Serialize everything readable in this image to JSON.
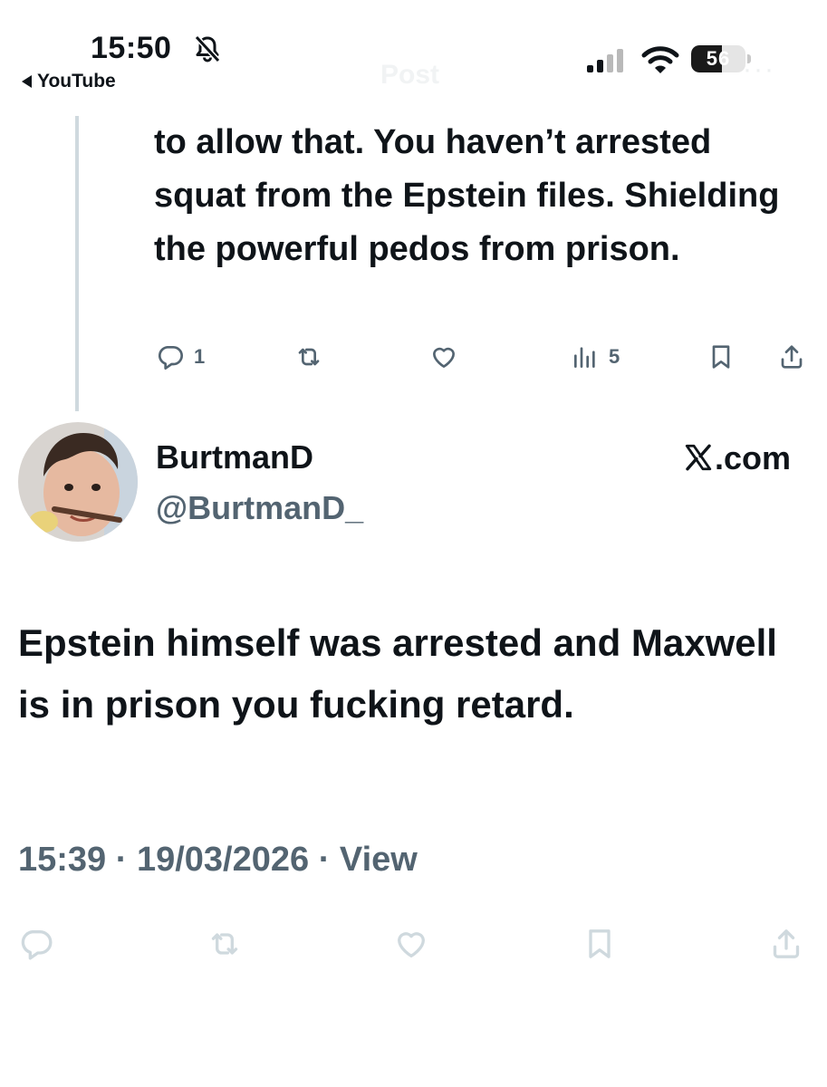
{
  "status_bar": {
    "time": "15:50",
    "back_app": "YouTube",
    "battery_level": "56",
    "battery_percent": 56
  },
  "nav": {
    "title": "Post",
    "more": "···"
  },
  "parent_tweet": {
    "text": "to allow that. You haven’t arrested squat from the Epstein files. Shielding the powerful pedos from prison.",
    "reply_count": "1",
    "view_count": "5"
  },
  "author": {
    "display_name": "BurtmanD",
    "handle": "@BurtmanD_"
  },
  "watermark": ".com",
  "main_tweet": {
    "text": "Epstein himself was arrested and Maxwell is in prison you fucking retard.",
    "timestamp": "15:39 · 19/03/2026 · View"
  },
  "icons": {
    "reply": "reply-icon",
    "repost": "repost-icon",
    "like": "like-icon",
    "views": "views-icon",
    "bookmark": "bookmark-icon",
    "share": "share-icon"
  },
  "colors": {
    "text": "#0f1419",
    "secondary": "#536471",
    "thread_line": "#cfd9de",
    "faded_icons": "#cfd9de"
  }
}
